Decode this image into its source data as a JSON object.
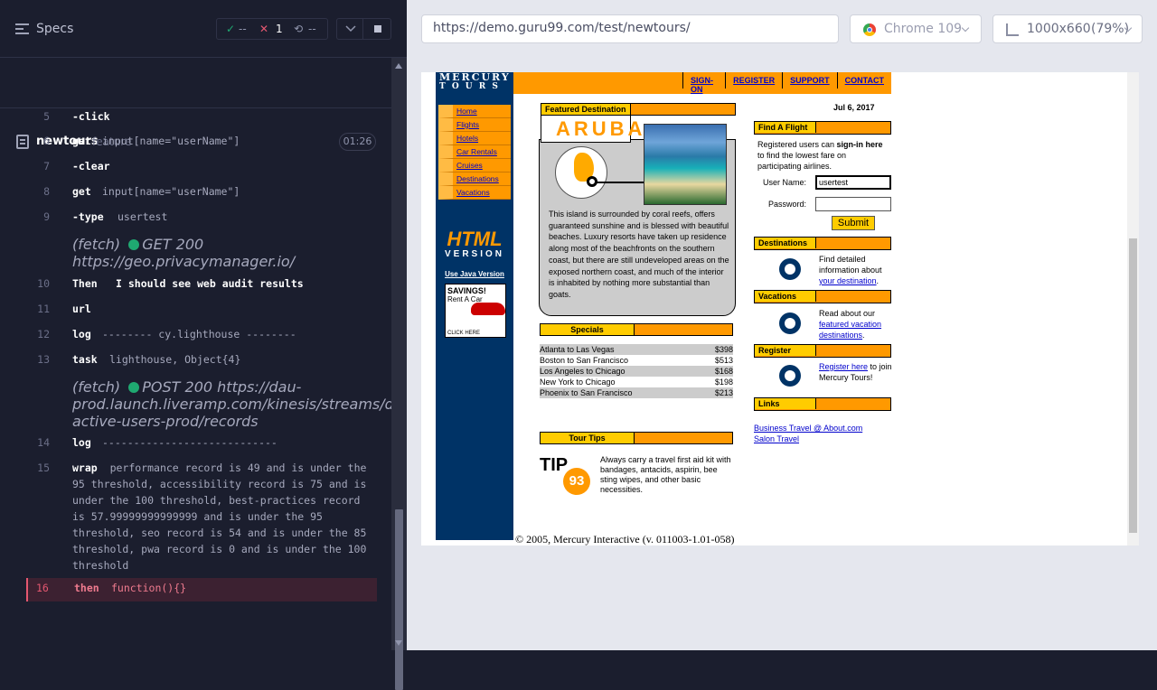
{
  "runner": {
    "specs_label": "Specs",
    "stats": {
      "passed": "--",
      "failed": "1",
      "pending": "--"
    },
    "file": {
      "name": "newtours",
      "kind": "feature",
      "duration": "01:26"
    },
    "commands": [
      {
        "line": "5",
        "kw": "-click",
        "arg": ""
      },
      {
        "line": "6",
        "kw": "get",
        "arg": "input[name=\"userName\"]"
      },
      {
        "line": "7",
        "kw": "-clear",
        "arg": ""
      },
      {
        "line": "8",
        "kw": "get",
        "arg": "input[name=\"userName\"]"
      },
      {
        "line": "9",
        "kw": "-type",
        "arg": "usertest"
      },
      {
        "line": "",
        "fetch": "(fetch)",
        "status": "GET 200",
        "url": "https://geo.privacymanager.io/"
      },
      {
        "line": "10",
        "kw": "Then",
        "arg": "I should see web audit results"
      },
      {
        "line": "11",
        "kw": "url",
        "arg": ""
      },
      {
        "line": "12",
        "kw": "log",
        "arg": "-------- cy.lighthouse --------"
      },
      {
        "line": "13",
        "kw": "task",
        "arg": "lighthouse, Object{4}"
      },
      {
        "line": "",
        "fetch": "(fetch)",
        "status": "POST 200",
        "url": "https://dau-prod.launch.liveramp.com/kinesis/streams/daily-active-users-prod/records"
      },
      {
        "line": "14",
        "kw": "log",
        "arg": "----------------------------"
      },
      {
        "line": "15",
        "kw": "wrap",
        "arg": "performance record is 49 and is under the 95 threshold, accessibility record is 75 and is under the 100 threshold, best-practices record is 57.99999999999999 and is under the 95 threshold, seo record is 54 and is under the 85 threshold, pwa record is 0 and is under the 100 threshold"
      },
      {
        "line": "16",
        "kw": "then",
        "arg": "function(){}"
      }
    ]
  },
  "preview": {
    "url": "https://demo.guru99.com/test/newtours/",
    "browser": "Chrome 109",
    "viewport": "1000x660",
    "zoom": "(79%)"
  },
  "site": {
    "logo_line1": "MERCURY",
    "logo_line2": "T O U R S",
    "top_links": [
      "SIGN-ON",
      "REGISTER",
      "SUPPORT",
      "CONTACT"
    ],
    "side_links": [
      "Home",
      "Flights",
      "Hotels",
      "Car Rentals",
      "Cruises",
      "Destinations",
      "Vacations"
    ],
    "html_word": "HTML",
    "version_word": "VERSION",
    "java_link": "Use Java Version",
    "savings_title": "SAVINGS!",
    "savings_sub": "Rent A Car",
    "savings_click": "CLICK HERE",
    "featured_title": "Featured Destination",
    "featured_name": "ARUBA",
    "featured_text": "This island is surrounded by coral reefs, offers guaranteed sunshine and is blessed with beautiful beaches. Luxury resorts have taken up residence along most of the beachfronts on the southern coast, but there are still undeveloped areas on the exposed northern coast, and much of the interior is inhabited by nothing more substantial than goats.",
    "specials_title": "Specials",
    "specials": [
      {
        "route": "Atlanta to Las Vegas",
        "price": "$398"
      },
      {
        "route": "Boston to San Francisco",
        "price": "$513"
      },
      {
        "route": "Los Angeles to Chicago",
        "price": "$168"
      },
      {
        "route": "New York to Chicago",
        "price": "$198"
      },
      {
        "route": "Phoenix to San Francisco",
        "price": "$213"
      }
    ],
    "tips_title": "Tour Tips",
    "tip_word": "TIP",
    "tip_number": "93",
    "tip_text": "Always carry a travel first aid kit with bandages, antacids, aspirin, bee sting wipes, and other basic necessities.",
    "date": "Jul 6, 2017",
    "find_title": "Find A Flight",
    "find_text_a": "Registered users can ",
    "find_text_b": "sign-in here",
    "find_text_c": " to find the lowest fare on participating airlines.",
    "username_label": "User Name:",
    "username_value": "usertest",
    "password_label": "Password:",
    "submit_label": "Submit",
    "destinations_title": "Destinations",
    "destinations_text": "Find detailed information about",
    "destinations_link": "your destination",
    "vacations_title": "Vacations",
    "vacations_text": "Read about our",
    "vacations_link": "featured vacation destinations",
    "register_title": "Register",
    "register_link": "Register here",
    "register_text": "to join Mercury Tours!",
    "links_title": "Links",
    "link1": "Business Travel @ About.com",
    "link2": "Salon Travel",
    "copyright": "© 2005, Mercury Interactive (v. 011003-1.01-058)"
  },
  "colors": {
    "accent_fail": "#e45770",
    "pass": "#1fa971",
    "mercury_orange": "#ff9900",
    "mercury_navy": "#003366"
  }
}
